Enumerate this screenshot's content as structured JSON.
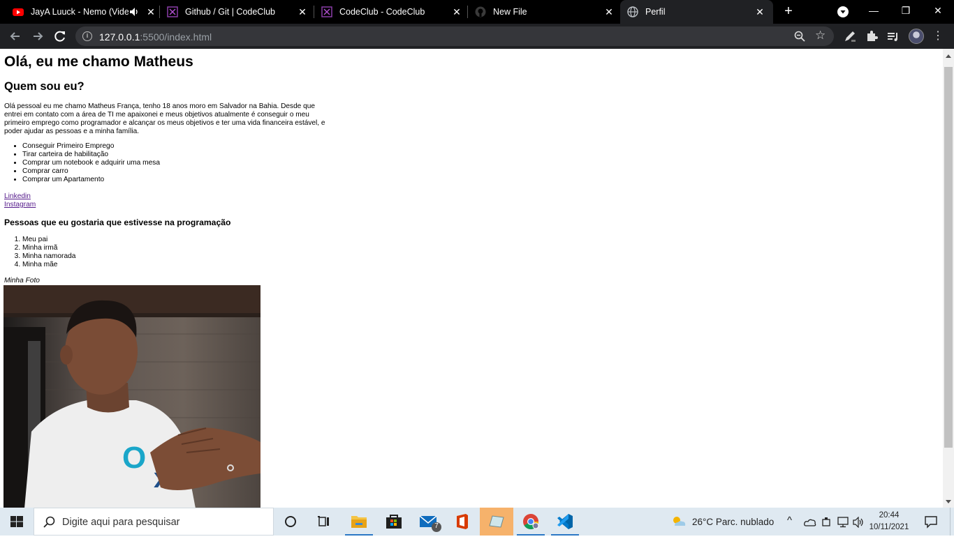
{
  "browser": {
    "tabs": [
      {
        "title": "JayA Luuck - Nemo (Vide",
        "active": false,
        "icon": "youtube-icon"
      },
      {
        "title": "Github / Git | CodeClub",
        "active": false,
        "icon": "codeclub-icon"
      },
      {
        "title": "CodeClub - CodeClub",
        "active": false,
        "icon": "codeclub-icon"
      },
      {
        "title": "New File",
        "active": false,
        "icon": "github-icon"
      },
      {
        "title": "Perfil",
        "active": true,
        "icon": "globe-icon"
      }
    ],
    "url_host": "127.0.0.1",
    "url_rest": ":5500/index.html"
  },
  "page": {
    "h1": "Olá, eu me chamo Matheus",
    "h2": "Quem sou eu?",
    "paragraph": "Olá pessoal eu me chamo Matheus França, tenho 18 anos moro em Salvador na Bahia. Desde que entrei em contato com a área de TI me apaixonei e meus objetivos atualmente é conseguir o meu primeiro emprego como programador e alcançar os meus objetivos e ter uma vida financeira estável, e poder ajudar as pessoas e a minha família.",
    "goals": [
      "Conseguir Primeiro Emprego",
      "Tirar carteira de habilitação",
      "Comprar um notebook e adquirir uma mesa",
      "Comprar carro",
      "Comprar um Apartamento"
    ],
    "links": [
      "Linkedin",
      "Instagram"
    ],
    "h4": "Pessoas que eu gostaria que estivesse na programação",
    "people": [
      "Meu pai",
      "Minha irmã",
      "Minha namorada",
      "Minha mãe"
    ],
    "photo_caption": "Minha Foto"
  },
  "taskbar": {
    "search_placeholder": "Digite aqui para pesquisar",
    "mail_badge": "7",
    "weather": "26°C  Parc. nublado",
    "time": "20:44",
    "date": "10/11/2021"
  },
  "colors": {
    "tabstrip": "#000000",
    "toolbar": "#202124",
    "link_visited": "#551a8b",
    "taskbar": "#dfe9f1"
  }
}
